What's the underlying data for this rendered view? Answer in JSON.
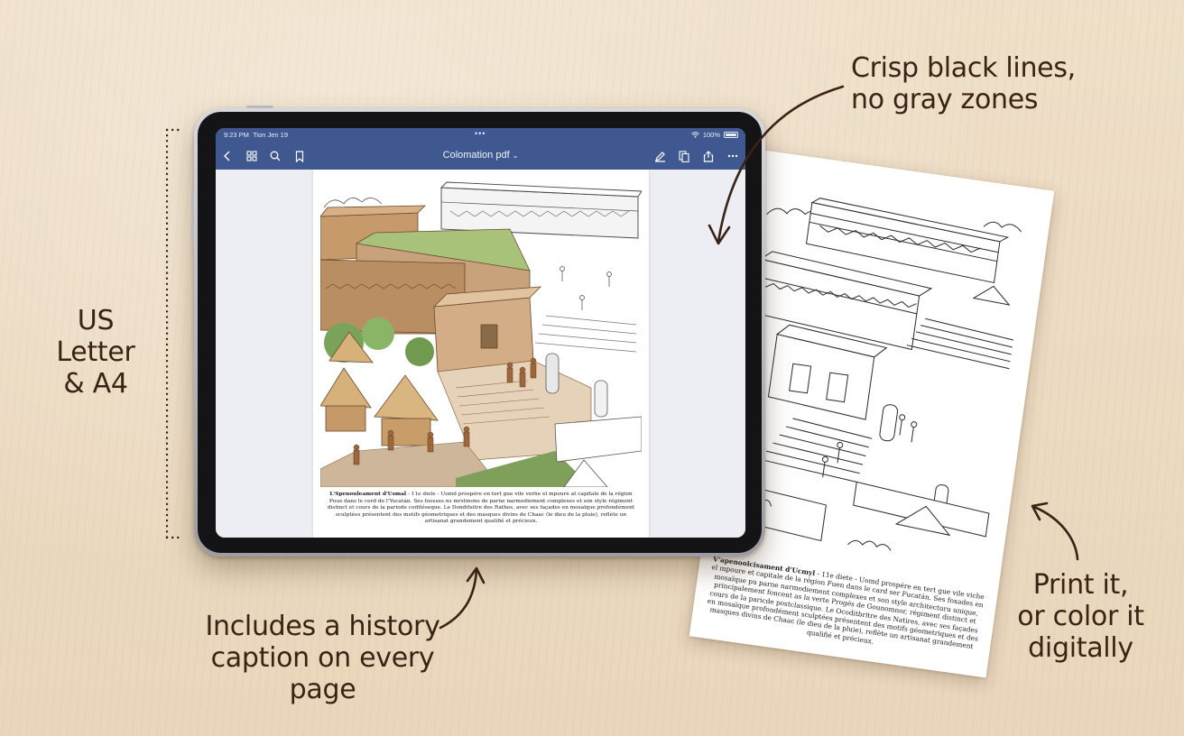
{
  "annotations": {
    "format": [
      "US Letter",
      "& A4"
    ],
    "line_quality": [
      "Crisp black lines,",
      "no gray zones"
    ],
    "history": [
      "Includes a history",
      "caption on every page"
    ],
    "print": [
      "Print it,",
      "or color it",
      "digitally"
    ]
  },
  "tablet": {
    "status_bar": {
      "time": "9:23 PM",
      "date": "Tion Jen 19",
      "center_dots": "•••",
      "battery": "100%"
    },
    "toolbar": {
      "document_title": "Colomation pdf",
      "title_chevron": "⌄",
      "icons": [
        "back-icon",
        "thumbnails-icon",
        "search-icon",
        "bookmark-icon",
        "annotate-icon",
        "pages-icon",
        "share-icon",
        "more-icon"
      ]
    },
    "page": {
      "caption_title": "L'Spenouleament d'Usmal",
      "caption_text": " - 11e diele - Uomd prospére en tert gue vile verhe el mpoure at capitale de la région Puus dans le cerd de l'Yucatán. Ses foosses ns mrstmons de parne narmodiement complexes et son style régiment distinct et cours de la pariode coditéseque. Le Donditsitre des Rathes, avec ses façades en mosaïque profondément sculptées présentent des motifs géometriques et des masques divins de Chaac (le dieu de la pluie), reflète un artisanat grandement qualifié et précieux."
    }
  },
  "printed_page": {
    "caption_title": "V'apenoolcisament d'Ucmyl",
    "caption_text": " - 11e diete - Uomd prospére en tert gue vile viche el mpoure et capitale de la région Fuen dans le card ser Fucatán. Ses foxades en mosaïque pu parne narmodiement complexes et son style architecturu unique, principalement foncent as la verte Progés de Gounomnor, régiment distinct et cours de la paricde postclassique. Le Ocoditbritre des Natires, avec ses façades en mosaïque profondément sculptées présentent des motifs géometriques et des masques divins de Chaac (le dieu de la pluie), reflète un artisanat grandement qualifié et précieux."
  },
  "colors": {
    "background": "#ead9c0",
    "annotation_text": "#3a2315",
    "toolbar_blue": "#3f5890"
  }
}
